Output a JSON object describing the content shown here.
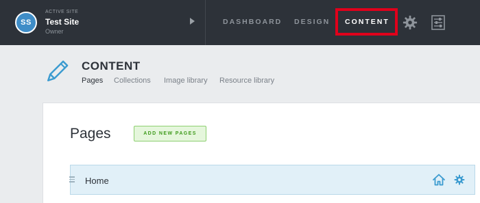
{
  "site": {
    "avatar_initials": "SS",
    "active_label": "ACTIVE SITE",
    "name": "Test Site",
    "role": "Owner"
  },
  "nav": {
    "dashboard": "DASHBOARD",
    "design": "DESIGN",
    "content": "CONTENT",
    "active": "content"
  },
  "header": {
    "title": "CONTENT",
    "tabs": [
      {
        "label": "Pages",
        "active": true
      },
      {
        "label": "Collections",
        "active": false
      },
      {
        "label": "Image library",
        "active": false
      },
      {
        "label": "Resource library",
        "active": false
      }
    ]
  },
  "main": {
    "heading": "Pages",
    "add_button": "ADD NEW PAGES",
    "pages": [
      {
        "label": "Home"
      }
    ]
  },
  "icons": {
    "site_switch": "caret-right-icon",
    "nav_settings": "gear-icon",
    "nav_preferences": "sliders-icon",
    "section": "pencil-icon",
    "row_home": "home-icon",
    "row_settings": "gear-icon"
  },
  "colors": {
    "topbar": "#2d3239",
    "accent_blue": "#3b9bd0",
    "highlight_box": "#e0001b",
    "add_button_bg": "#e5f6dc",
    "add_button_text": "#3d9a1a",
    "row_bg": "#e1f0f8"
  }
}
